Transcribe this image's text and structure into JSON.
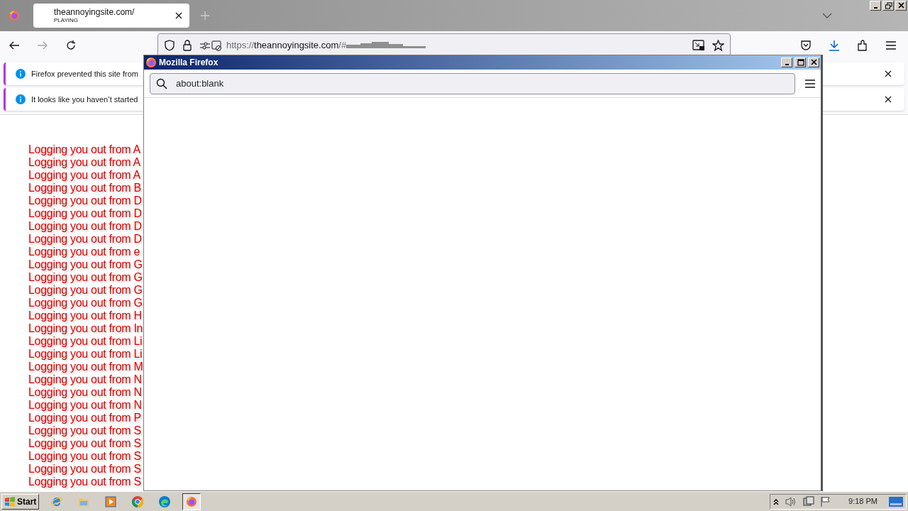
{
  "tab_strip": {
    "tabs": [
      {
        "title": "theannoyingsite.com/",
        "subtitle": "PLAYING",
        "selected": true
      }
    ]
  },
  "address_bar": {
    "scheme": "https://",
    "host": "theannoyingsite.com",
    "rest": "/#"
  },
  "notifications": [
    {
      "text": "Firefox prevented this site from"
    },
    {
      "text": "It looks like you haven’t started"
    }
  ],
  "page": {
    "log_lines": [
      "Logging you out from A",
      "Logging you out from A",
      "Logging you out from A",
      "Logging you out from B",
      "Logging you out from D",
      "Logging you out from D",
      "Logging you out from D",
      "Logging you out from D",
      "Logging you out from e",
      "Logging you out from G",
      "Logging you out from G",
      "Logging you out from G",
      "Logging you out from G",
      "Logging you out from H",
      "Logging you out from In",
      "Logging you out from Li",
      "Logging you out from Li",
      "Logging you out from M",
      "Logging you out from N",
      "Logging you out from N",
      "Logging you out from N",
      "Logging you out from P",
      "Logging you out from S",
      "Logging you out from S",
      "Logging you out from S",
      "Logging you out from S",
      "Logging you out from S"
    ]
  },
  "popup": {
    "title": "Mozilla Firefox",
    "address": "about:blank"
  },
  "taskbar": {
    "start": "Start",
    "clock": "9:18 PM",
    "apps": [
      {
        "kind": "ie",
        "active": false
      },
      {
        "kind": "folder",
        "active": false
      },
      {
        "kind": "media",
        "active": false
      },
      {
        "kind": "chrome",
        "active": false
      },
      {
        "kind": "edge",
        "active": false
      },
      {
        "kind": "firefox",
        "active": true
      }
    ]
  }
}
